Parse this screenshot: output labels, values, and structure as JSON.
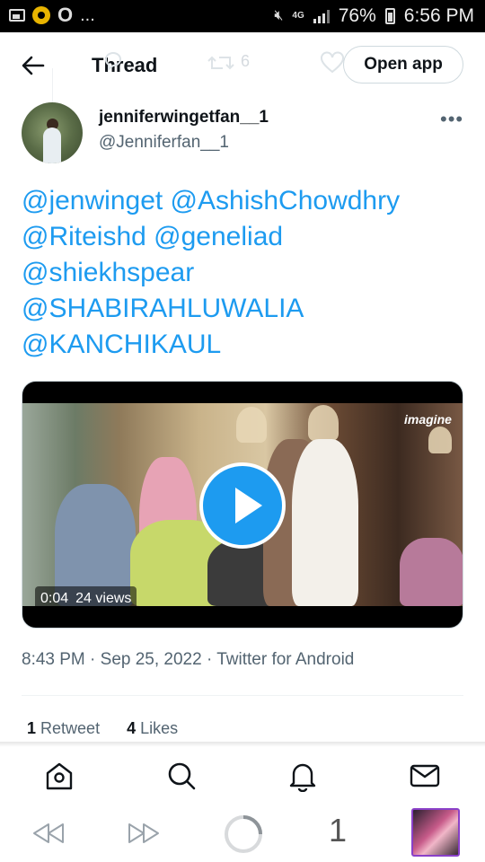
{
  "status_bar": {
    "left_icons": [
      "image-notification-icon",
      "coin-app-icon",
      "o-app-icon"
    ],
    "more_indicator": "...",
    "network_type": "4G",
    "battery_percent": "76%",
    "time": "6:56 PM"
  },
  "top_bar": {
    "title": "Thread",
    "open_app_label": "Open app",
    "ghost_retweet_count": "6"
  },
  "tweet": {
    "author_name": "jenniferwingetfan__1",
    "author_handle": "@Jenniferfan__1",
    "mentions": [
      "@jenwinget @AshishChowdhry",
      "@Riteishd @geneliad",
      "@shiekhspear",
      "@SHABIRAHLUWALIA",
      "@KANCHIKAUL"
    ],
    "video": {
      "logo_text": "imagine",
      "duration": "0:04",
      "views": "24 views"
    },
    "timestamp": "8:43 PM · Sep 25, 2022 · Twitter for Android",
    "stats": {
      "retweet_count": "1",
      "retweet_label": "Retweet",
      "like_count": "4",
      "like_label": "Likes"
    }
  },
  "bottom_nav": {
    "items": [
      "home-icon",
      "search-icon",
      "notifications-icon",
      "messages-icon"
    ]
  },
  "browser_bar": {
    "tab_count": "1"
  },
  "colors": {
    "accent": "#1d9bf0",
    "text_primary": "#0f1419",
    "text_secondary": "#536471"
  }
}
